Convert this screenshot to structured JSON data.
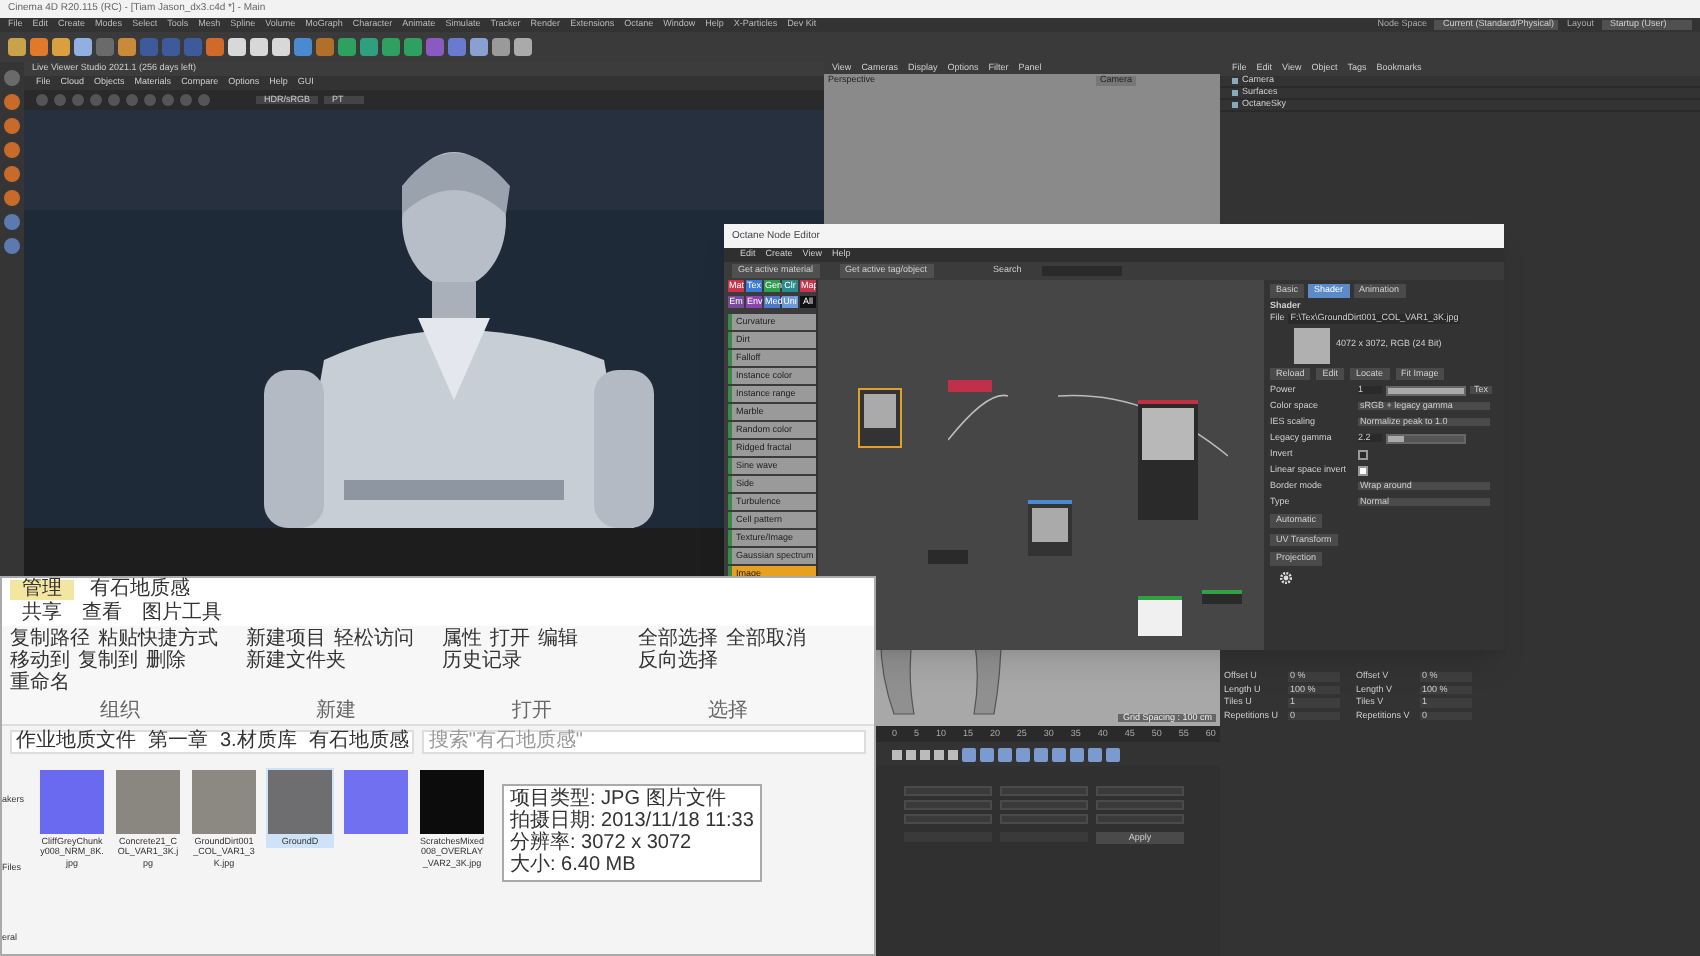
{
  "app": {
    "title": "Cinema 4D R20.115 (RC) - [Tiam Jason_dx3.c4d *] - Main",
    "menu": [
      "File",
      "Edit",
      "Create",
      "Modes",
      "Select",
      "Tools",
      "Mesh",
      "Spline",
      "Volume",
      "MoGraph",
      "Character",
      "Animate",
      "Simulate",
      "Tracker",
      "Render",
      "Extensions",
      "Octane",
      "Window",
      "Help",
      "X-Particles",
      "Dev Kit"
    ],
    "node_space_label": "Node Space",
    "node_space_value": "Current (Standard/Physical)",
    "layout_label": "Layout",
    "layout_value": "Startup (User)"
  },
  "live_viewer": {
    "title": "Live Viewer Studio 2021.1 (256 days left)",
    "menu": [
      "File",
      "Cloud",
      "Objects",
      "Materials",
      "Compare",
      "Options",
      "Help",
      "GUI"
    ],
    "mode": "HDR/sRGB",
    "channel": "PT"
  },
  "viewport": {
    "menu": [
      "View",
      "Cameras",
      "Display",
      "Options",
      "Filter",
      "Panel"
    ],
    "name": "Perspective",
    "camera": "Camera",
    "grid": "Grid Spacing : 100 cm",
    "ticks": [
      "0",
      "5",
      "10",
      "15",
      "20",
      "25",
      "30",
      "35",
      "40",
      "45",
      "50",
      "55",
      "60"
    ]
  },
  "objects": {
    "menu": [
      "File",
      "Edit",
      "View",
      "Object",
      "Tags",
      "Bookmarks"
    ],
    "items": [
      {
        "name": "Camera"
      },
      {
        "name": "Surfaces"
      },
      {
        "name": "OctaneSky"
      }
    ]
  },
  "node_editor": {
    "title": "Octane Node Editor",
    "menu": [
      "Edit",
      "Create",
      "View",
      "Help"
    ],
    "buttons": [
      "Get active material",
      "Get active tag/object"
    ],
    "search_label": "Search",
    "categories": [
      {
        "label": "Mat",
        "color": "#c8344c"
      },
      {
        "label": "Tex",
        "color": "#3a7bd5"
      },
      {
        "label": "Gen",
        "color": "#2e9e4f"
      },
      {
        "label": "Clr",
        "color": "#2a8c8c"
      },
      {
        "label": "Map",
        "color": "#c8344c"
      },
      {
        "label": "Em",
        "color": "#7a4a9c"
      },
      {
        "label": "Env",
        "color": "#8a44b0"
      },
      {
        "label": "Med",
        "color": "#4a7ac8"
      },
      {
        "label": "Uni",
        "color": "#6a9ad8"
      },
      {
        "label": "All",
        "color": "#111111"
      }
    ],
    "node_list": [
      {
        "label": "Curvature",
        "selected": false
      },
      {
        "label": "Dirt",
        "selected": false
      },
      {
        "label": "Falloff",
        "selected": false
      },
      {
        "label": "Instance color",
        "selected": false
      },
      {
        "label": "Instance range",
        "selected": false
      },
      {
        "label": "Marble",
        "selected": false
      },
      {
        "label": "Random color",
        "selected": false
      },
      {
        "label": "Ridged fractal",
        "selected": false
      },
      {
        "label": "Sine wave",
        "selected": false
      },
      {
        "label": "Side",
        "selected": false
      },
      {
        "label": "Turbulence",
        "selected": false
      },
      {
        "label": "Cell pattern",
        "selected": false
      },
      {
        "label": "Texture/Image",
        "selected": false
      },
      {
        "label": "Gaussian spectrum",
        "selected": false
      },
      {
        "label": "Image",
        "selected": true
      }
    ],
    "tabs": [
      {
        "label": "Basic",
        "selected": false
      },
      {
        "label": "Shader",
        "selected": true
      },
      {
        "label": "Animation",
        "selected": false
      }
    ],
    "section": "Shader",
    "file_label": "File",
    "file": "F:\\Tex\\GroundDirt001_COL_VAR1_3K.jpg",
    "resolution": "4072 x 3072, RGB (24 Bit)",
    "file_buttons": [
      "Reload",
      "Edit",
      "Locate",
      "Fit Image"
    ],
    "params": [
      {
        "kind": "slider",
        "label": "Power",
        "value": "1",
        "level": 1,
        "button": "Tex"
      },
      {
        "kind": "select",
        "label": "Color space",
        "value": "sRGB + legacy gamma"
      },
      {
        "kind": "select",
        "label": "IES scaling",
        "value": "Normalize peak to 1.0"
      },
      {
        "kind": "slider",
        "label": "Legacy gamma",
        "value": "2.2",
        "level": 0.22
      },
      {
        "kind": "check",
        "label": "Invert",
        "checked": false
      },
      {
        "kind": "check",
        "label": "Linear space invert",
        "checked": true
      },
      {
        "kind": "select",
        "label": "Border mode",
        "value": "Wrap around"
      },
      {
        "kind": "select",
        "label": "Type",
        "value": "Normal"
      }
    ],
    "bottom_buttons": [
      "Automatic",
      "UV Transform",
      "Projection"
    ]
  },
  "attributes": {
    "fields": [
      {
        "label": "Offset U",
        "value": "0 %"
      },
      {
        "label": "Offset V",
        "value": "0 %"
      },
      {
        "label": "Length U",
        "value": "100 %"
      },
      {
        "label": "Length V",
        "value": "100 %"
      },
      {
        "label": "Tiles U",
        "value": "1"
      },
      {
        "label": "Tiles V",
        "value": "1"
      },
      {
        "label": "Repetitions U",
        "value": "0"
      },
      {
        "label": "Repetitions V",
        "value": "0"
      }
    ],
    "apply": "Apply"
  },
  "explorer": {
    "context_tab": "管理",
    "title": "有石地质感",
    "ribbon_tabs": [
      "共享",
      "查看",
      "图片工具"
    ],
    "groups": [
      {
        "label": "组织",
        "items": [
          "复制路径",
          "粘贴快捷方式",
          "移动到",
          "复制到",
          "删除",
          "重命名"
        ]
      },
      {
        "label": "新建",
        "items": [
          "新建项目",
          "轻松访问",
          "新建文件夹"
        ]
      },
      {
        "label": "打开",
        "items": [
          "属性",
          "打开",
          "编辑",
          "历史记录"
        ]
      },
      {
        "label": "选择",
        "items": [
          "全部选择",
          "全部取消",
          "反向选择"
        ]
      }
    ],
    "path": [
      "作业地质文件",
      "第一章",
      "3.材质库",
      "有石地质感"
    ],
    "search_placeholder": "搜索\"有石地质感\"",
    "nav": [
      "akers",
      "Files",
      "eral"
    ],
    "files": [
      {
        "name": "CliffGreyChunky008_NRM_8K.jpg",
        "color": "#6a6af0",
        "selected": false
      },
      {
        "name": "Concrete21_COL_VAR1_3K.jpg",
        "color": "#8a8680",
        "selected": false
      },
      {
        "name": "GroundDirt001_COL_VAR1_3K.jpg",
        "color": "#8c8882",
        "selected": false
      },
      {
        "name": "GroundD",
        "color": "#6e6e70",
        "selected": true
      },
      {
        "color": "#7070f0",
        "selected": false
      },
      {
        "name": "ScratchesMixed008_OVERLAY_VAR2_3K.jpg",
        "color": "#0c0c0c",
        "selected": false
      }
    ],
    "tooltip": [
      "项目类型: JPG 图片文件",
      "拍摄日期: 2013/11/18 11:33",
      "分辨率: 3072 x 3072",
      "大小: 6.40 MB"
    ]
  }
}
